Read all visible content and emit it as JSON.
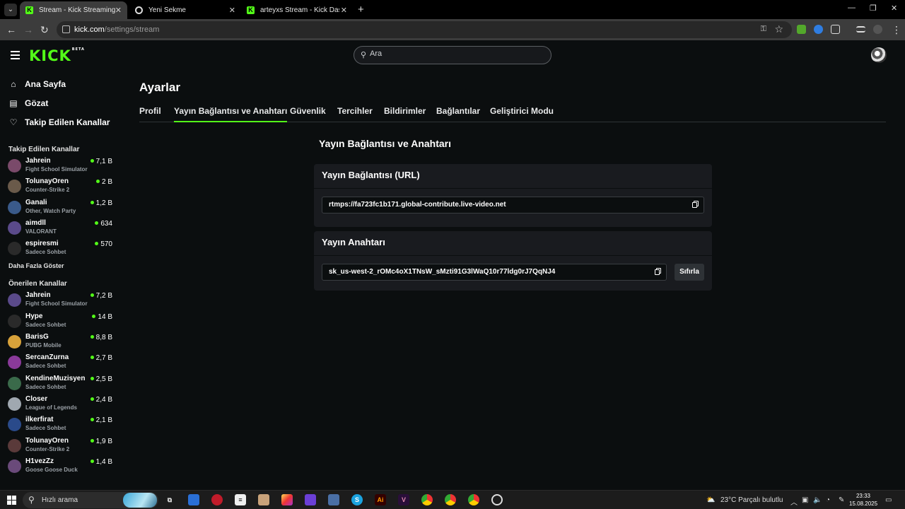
{
  "browser": {
    "tabs": [
      {
        "title": "Stream - Kick Streaming",
        "favicon": "kick-icon"
      },
      {
        "title": "Yeni Sekme",
        "favicon": "chrome-icon"
      },
      {
        "title": "arteyxs Stream - Kick Dashboa",
        "favicon": "kick-icon"
      }
    ],
    "url_host": "kick.com",
    "url_path": "/settings/stream"
  },
  "header": {
    "logo_text": "KICK",
    "logo_badge": "BETA",
    "search_placeholder": "Ara"
  },
  "sidebar": {
    "nav": [
      {
        "label": "Ana Sayfa",
        "icon": "home-icon"
      },
      {
        "label": "Gözat",
        "icon": "browse-icon"
      },
      {
        "label": "Takip Edilen Kanallar",
        "icon": "heart-icon"
      }
    ],
    "followed_title": "Takip Edilen Kanallar",
    "followed": [
      {
        "name": "Jahrein",
        "game": "Fight School Simulator",
        "viewers": "7,1 B"
      },
      {
        "name": "TolunayOren",
        "game": "Counter-Strike 2",
        "viewers": "2 B"
      },
      {
        "name": "Ganali",
        "game": "Other, Watch Party",
        "viewers": "1,2 B"
      },
      {
        "name": "aimdll",
        "game": "VALORANT",
        "viewers": "634"
      },
      {
        "name": "espiresmi",
        "game": "Sadece Sohbet",
        "viewers": "570"
      }
    ],
    "show_more": "Daha Fazla Göster",
    "recommended_title": "Önerilen Kanallar",
    "recommended": [
      {
        "name": "Jahrein",
        "game": "Fight School Simulator",
        "viewers": "7,2 B"
      },
      {
        "name": "Hype",
        "game": "Sadece Sohbet",
        "viewers": "14 B"
      },
      {
        "name": "BarisG",
        "game": "PUBG Mobile",
        "viewers": "8,8 B"
      },
      {
        "name": "SercanZurna",
        "game": "Sadece Sohbet",
        "viewers": "2,7 B"
      },
      {
        "name": "KendineMuzisyen",
        "game": "Sadece Sohbet",
        "viewers": "2,5 B"
      },
      {
        "name": "Closer",
        "game": "League of Legends",
        "viewers": "2,4 B"
      },
      {
        "name": "ilkerfirat",
        "game": "Sadece Sohbet",
        "viewers": "2,1 B"
      },
      {
        "name": "TolunayOren",
        "game": "Counter-Strike 2",
        "viewers": "1,9 B"
      },
      {
        "name": "H1vezZz",
        "game": "Goose Goose Duck",
        "viewers": "1,4 B"
      }
    ]
  },
  "settings": {
    "title": "Ayarlar",
    "tabs": [
      "Profil",
      "Yayın Bağlantısı ve Anahtarı",
      "Güvenlik",
      "Tercihler",
      "Bildirimler",
      "Bağlantılar",
      "Geliştirici Modu"
    ],
    "selected_tab": "Yayın Bağlantısı ve Anahtarı",
    "panel_title": "Yayın Bağlantısı ve Anahtarı",
    "url_label": "Yayın Bağlantısı (URL)",
    "url_value": "rtmps://fa723fc1b171.global-contribute.live-video.net",
    "key_label": "Yayın Anahtarı",
    "key_value": "sk_us-west-2_rOMc4oX1TNsW_sMzti91G3lWaQ10r77ldg0rJ7QqNJ4",
    "reset_label": "Sıfırla"
  },
  "taskbar": {
    "search_label": "Hızlı arama",
    "weather": "23°C  Parçalı bulutlu",
    "time": "23:33",
    "date": "15.08.2025"
  },
  "colors": {
    "accent": "#53fc18",
    "background": "#0b0e0f",
    "card": "#191b1f"
  }
}
